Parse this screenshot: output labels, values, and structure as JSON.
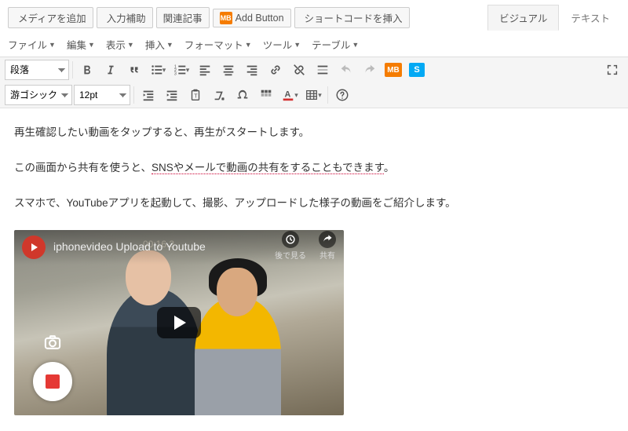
{
  "topButtons": {
    "addMedia": "メディアを追加",
    "inputAssist": "入力補助",
    "related": "関連記事",
    "addButton": "Add Button",
    "addButtonBadge": "MB",
    "shortcode": "ショートコードを挿入"
  },
  "editorTabs": {
    "visual": "ビジュアル",
    "text": "テキスト"
  },
  "menus": {
    "file": "ファイル",
    "edit": "編集",
    "view": "表示",
    "insert": "挿入",
    "format": "フォーマット",
    "tools": "ツール",
    "table": "テーブル"
  },
  "dropdowns": {
    "blockFormat": "段落",
    "fontFamily": "游ゴシック体",
    "fontSize": "12pt"
  },
  "badges": {
    "mb": "MB",
    "s": "S"
  },
  "content": {
    "p1": "再生確認したい動画をタップすると、再生がスタートします。",
    "p2a": "この画面から共有を使うと、",
    "p2u": "SNSやメールで動画の共有をすることもできます",
    "p2b": "。",
    "p3": "スマホで、YouTubeアプリを起動して、撮影、アップロードした様子の動画をご紹介します。"
  },
  "video": {
    "title": "iphonevideo Upload to Youtube",
    "timestamp": "00:16.2",
    "watchLater": "後で見る",
    "share": "共有"
  }
}
